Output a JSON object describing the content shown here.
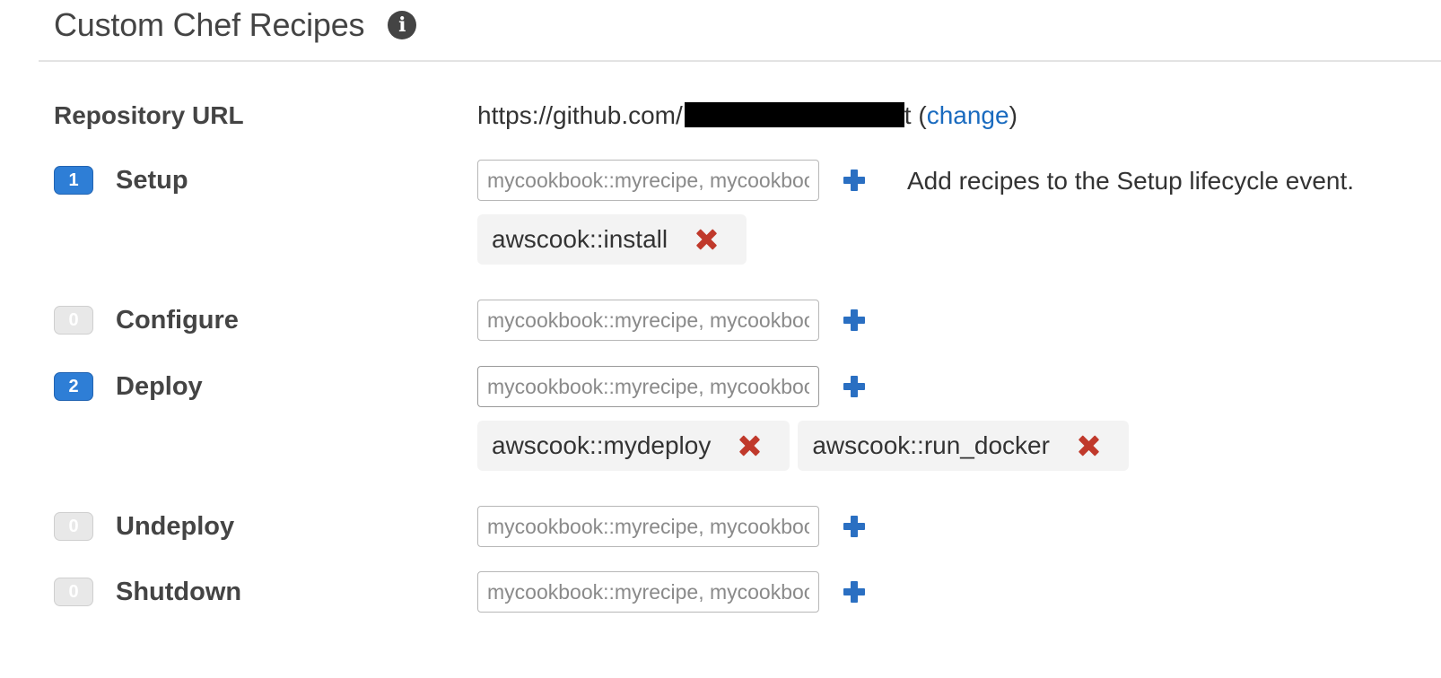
{
  "header": {
    "title": "Custom Chef Recipes",
    "info_icon": "info-circle-icon",
    "info_glyph": "i"
  },
  "repository": {
    "label": "Repository URL",
    "url_prefix": "https://github.com/",
    "url_suffix": "t",
    "open_paren": " (",
    "change_link": "change",
    "close_paren": ")"
  },
  "colors": {
    "accent_blue": "#2e7ed6",
    "link_blue": "#1a6bbf",
    "remove_red": "#c0392b",
    "plus_blue": "#2a6fc2"
  },
  "stages": [
    {
      "count": "1",
      "name": "Setup",
      "placeholder": "mycookbook::myrecipe, mycookbook::otherrecipe",
      "value": "",
      "help": "Add recipes to the Setup lifecycle event.",
      "recipes": [
        "awscook::install"
      ]
    },
    {
      "count": "0",
      "name": "Configure",
      "placeholder": "mycookbook::myrecipe, mycookbook::otherrecipe",
      "value": "",
      "recipes": []
    },
    {
      "count": "2",
      "name": "Deploy",
      "placeholder": "mycookbook::myrecipe, mycookbook::otherrecipe",
      "value": "",
      "recipes": [
        "awscook::mydeploy",
        "awscook::run_docker"
      ]
    },
    {
      "count": "0",
      "name": "Undeploy",
      "placeholder": "mycookbook::myrecipe, mycookbook::otherrecipe",
      "value": "",
      "recipes": []
    },
    {
      "count": "0",
      "name": "Shutdown",
      "placeholder": "mycookbook::myrecipe, mycookbook::otherrecipe",
      "value": "",
      "recipes": []
    }
  ]
}
